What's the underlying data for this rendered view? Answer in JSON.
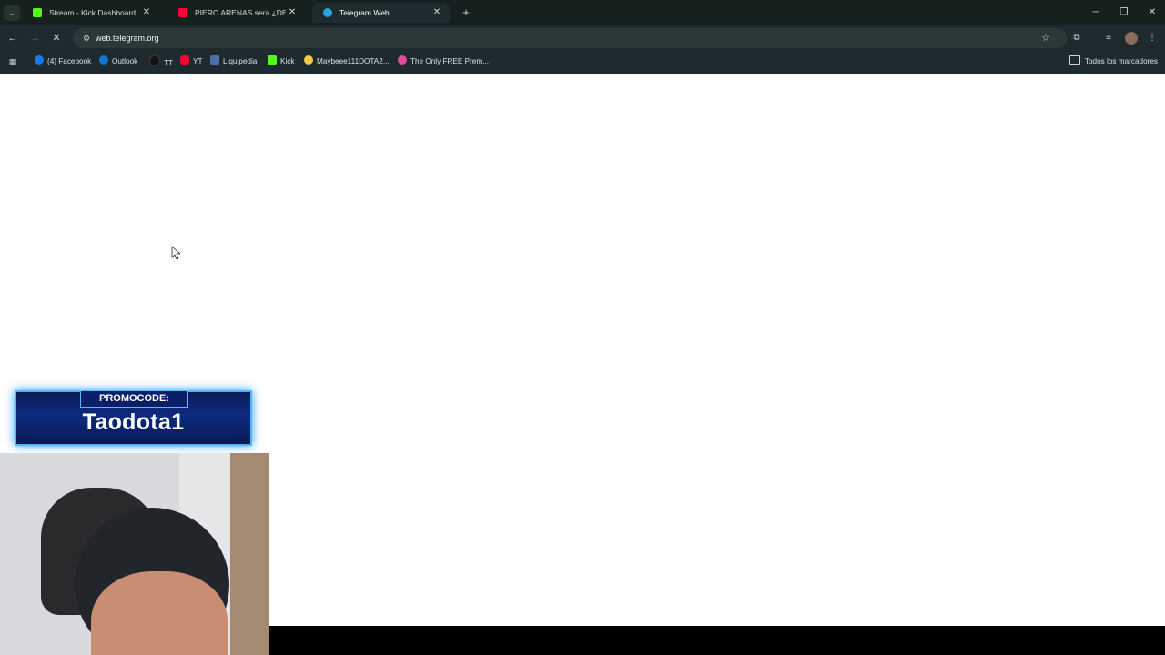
{
  "tabs": [
    {
      "label": "Stream - Kick Dashboard",
      "favicon_color": "#53fc18",
      "favicon": "kick-icon"
    },
    {
      "label": "PIERO ARENAS será ¿DENU",
      "favicon_color": "#ff0033",
      "favicon": "youtube-icon"
    },
    {
      "label": "Telegram Web",
      "favicon_color": "#2aa3e0",
      "favicon": "telegram-icon",
      "active": true
    }
  ],
  "address_bar": {
    "url": "web.telegram.org"
  },
  "bookmarks": [
    {
      "label": "(4) Facebook",
      "icon_color": "#1877f2",
      "icon": "facebook-icon"
    },
    {
      "label": "Outlook",
      "icon_color": "#0f78d4",
      "icon": "outlook-icon"
    },
    {
      "label": "TT",
      "icon_color": "#111111",
      "icon": "tiktok-icon"
    },
    {
      "label": "YT",
      "icon_color": "#ff0033",
      "icon": "youtube-icon"
    },
    {
      "label": "Liquipedia",
      "icon_color": "#4c6fae",
      "icon": "liquipedia-icon"
    },
    {
      "label": "Kick",
      "icon_color": "#53fc18",
      "icon": "kick-icon"
    },
    {
      "label": "Maybeee111DOTA2...",
      "icon_color": "#f2c94c",
      "icon": "smiley-icon"
    },
    {
      "label": "The Only FREE Prem...",
      "icon_color": "#e24aa0",
      "icon": "shield-icon"
    }
  ],
  "all_bookmarks": "Todos los marcadores",
  "promo": {
    "label": "PROMOCODE:",
    "code": "Taodota1"
  }
}
